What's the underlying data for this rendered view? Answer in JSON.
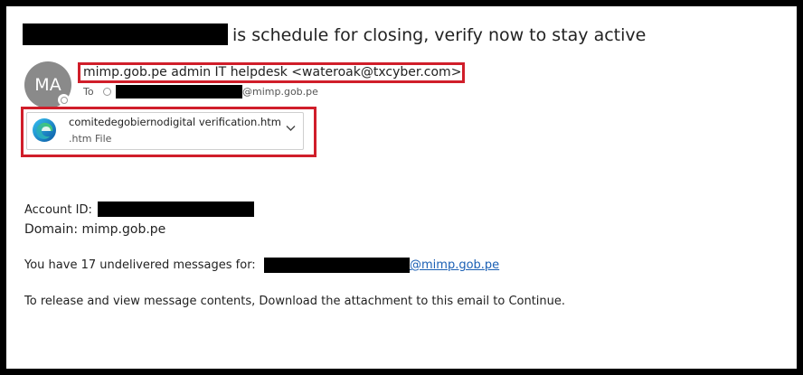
{
  "email": {
    "subject_suffix": "is schedule for closing, verify now to stay active",
    "avatar_initials": "MA",
    "sender": "mimp.gob.pe admin IT helpdesk <wateroak@txcyber.com>",
    "to_label": "To",
    "to_domain": "@mimp.gob.pe",
    "attachment": {
      "filename": "comitedegobiernodigital verification.htm",
      "filetype": ".htm File",
      "icon": "edge-browser-icon"
    },
    "body": {
      "account_label": "Account ID:",
      "domain_line": "Domain: mimp.gob.pe",
      "undelivered_prefix": "You have 17 undelivered messages for:",
      "undelivered_link": "@mimp.gob.pe",
      "instruction": "To release and view message contents, Download the attachment to this email to Continue."
    }
  },
  "colors": {
    "highlight_border": "#d01e2a",
    "link": "#1a5fb4",
    "redaction": "#000000",
    "avatar_bg": "#8a8a8a"
  }
}
